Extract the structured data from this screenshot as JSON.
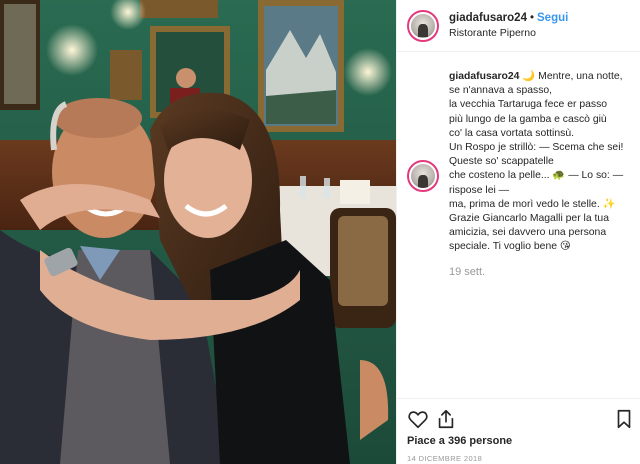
{
  "post": {
    "username": "giadafusaro24",
    "follow_label": "Segui",
    "location": "Ristorante Piperno",
    "caption": {
      "user": "giadafusaro24",
      "text": " 🌙 Mentre, una notte,\nse n'annava a spasso,\nla vecchia Tartaruga fece er passo\npiù lungo de la gamba e cascò giù\nco' la casa vortata sottinsù.\nUn Rospo je strillò: — Scema che sei!\nQueste so' scappatelle\nche costeno la pelle... 🐢 — Lo so: —\nrispose lei —\nma, prima de morì vedo le stelle. ✨\nGrazie Giancarlo Magalli per la tua\namicizia, sei davvero una persona\nspeciale. Ti voglio bene 😘"
    },
    "time_ago": "19 sett.",
    "likes": "Piace a 396 persone",
    "date": "14 DICEMBRE 2018",
    "icons": [
      "heart-icon",
      "share-icon",
      "bookmark-icon"
    ]
  },
  "colors": {
    "follow": "#3897f0",
    "story_ring": "#e23a7c",
    "wall": "#1f5a46"
  }
}
